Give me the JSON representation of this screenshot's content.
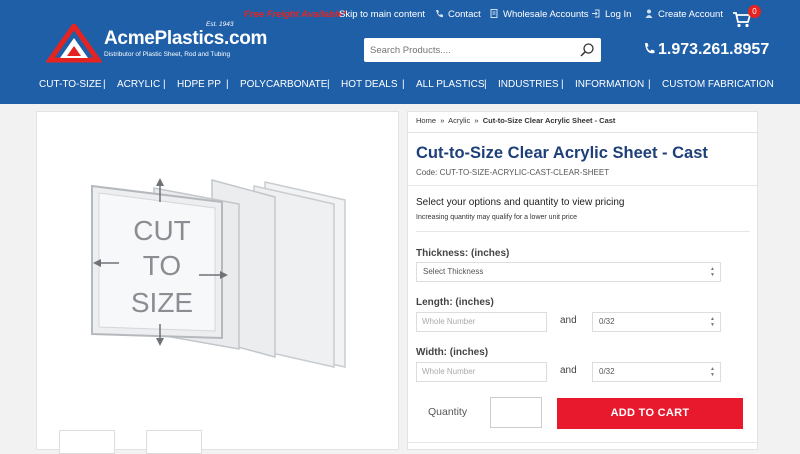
{
  "topbar": {
    "free_freight": "Free Freight Available*",
    "skip": "Skip to main content",
    "contact": "Contact",
    "wholesale": "Wholesale Accounts",
    "login": "Log In",
    "create_account": "Create Account",
    "cart_count": "0"
  },
  "logo": {
    "name": "AcmePlastics.com",
    "est": "Est. 1943",
    "tagline": "Distributor of Plastic Sheet, Rod and Tubing"
  },
  "search": {
    "placeholder": "Search Products...."
  },
  "phone": "1.973.261.8957",
  "nav": [
    "CUT-TO-SIZE",
    "ACRYLIC",
    "HDPE PP",
    "POLYCARBONATE",
    "HOT DEALS",
    "ALL PLASTICS",
    "INDUSTRIES",
    "INFORMATION",
    "CUSTOM FABRICATION"
  ],
  "breadcrumb": {
    "home": "Home",
    "sep": "»",
    "cat": "Acrylic",
    "current": "Cut-to-Size Clear Acrylic Sheet - Cast"
  },
  "product": {
    "title": "Cut-to-Size Clear Acrylic Sheet - Cast",
    "code": "Code: CUT-TO-SIZE-ACRYLIC-CAST-CLEAR-SHEET",
    "select_msg": "Select your options and quantity to view pricing",
    "qty_msg": "Increasing quantity may qualify for a lower unit price"
  },
  "image_text": [
    "CUT",
    "TO",
    "SIZE"
  ],
  "options": {
    "thickness_label": "Thickness: (inches)",
    "thickness_value": "Select Thickness",
    "length_label": "Length: (inches)",
    "width_label": "Width: (inches)",
    "whole_placeholder": "Whole Number",
    "and": "and",
    "fraction_value": "0/32",
    "quantity_label": "Quantity",
    "add_to_cart": "ADD TO CART"
  },
  "colors": {
    "header": "#1f5fa8",
    "accent": "#e8192c",
    "title": "#1d3f7a"
  }
}
